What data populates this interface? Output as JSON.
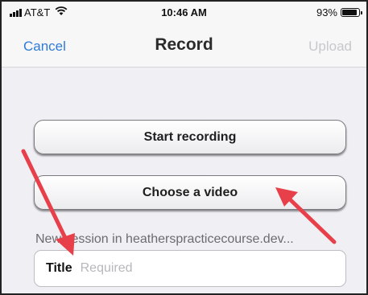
{
  "status_bar": {
    "carrier": "AT&T",
    "time": "10:46 AM",
    "battery": "93%",
    "battery_level": 0.93,
    "icons": [
      "signal-icon",
      "wifi-icon",
      "battery-icon"
    ]
  },
  "nav": {
    "cancel_label": "Cancel",
    "title": "Record",
    "upload_label": "Upload"
  },
  "actions": {
    "start_recording_label": "Start recording",
    "choose_video_label": "Choose a video"
  },
  "session": {
    "label": "New session in heatherspracticecourse.dev..."
  },
  "title_field": {
    "label": "Title",
    "placeholder": "Required",
    "value": ""
  },
  "colors": {
    "accent": "#2f7bd6",
    "disabled": "#c8c8cc",
    "annotation_arrow": "#e8404a",
    "background": "#efeff4"
  }
}
